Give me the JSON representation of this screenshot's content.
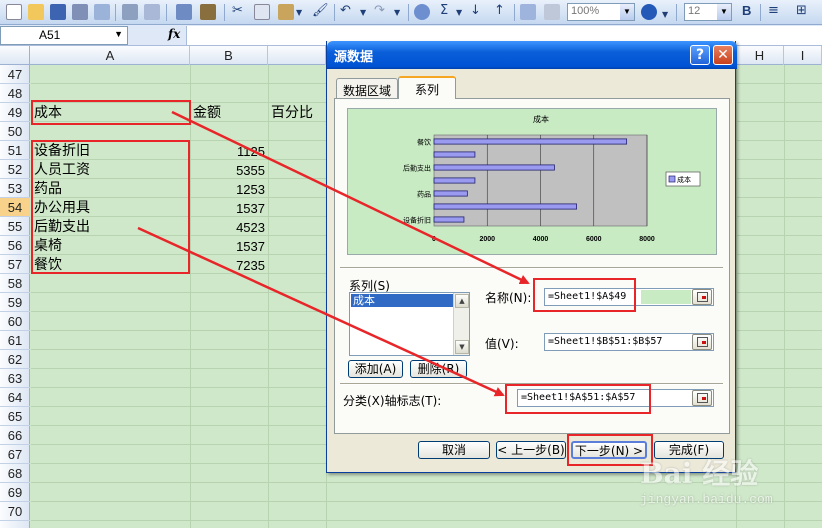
{
  "toolbar": {
    "zoom": "100%",
    "font_size": "12",
    "bold_label": "B"
  },
  "formula_bar": {
    "name_box": "A51",
    "fx_label": "fx",
    "formula": ""
  },
  "sheet": {
    "columns": [
      "A",
      "B",
      "",
      "",
      "",
      "",
      "",
      "H",
      "I"
    ],
    "rows": [
      "47",
      "48",
      "49",
      "50",
      "51",
      "52",
      "53",
      "54",
      "55",
      "56",
      "57",
      "58",
      "59",
      "60",
      "61",
      "62",
      "63",
      "64",
      "65",
      "66",
      "67",
      "68",
      "69",
      "70"
    ],
    "selected_row": "54",
    "header_row": {
      "a": "成本",
      "b": "金额",
      "c": "百分比"
    },
    "data_rows": [
      {
        "label": "设备折旧",
        "value": "1125"
      },
      {
        "label": "人员工资",
        "value": "5355"
      },
      {
        "label": "药品",
        "value": "1253"
      },
      {
        "label": "办公用具",
        "value": "1537"
      },
      {
        "label": "后勤支出",
        "value": "4523"
      },
      {
        "label": "桌椅",
        "value": "1537"
      },
      {
        "label": "餐饮",
        "value": "7235"
      }
    ]
  },
  "dialog": {
    "title": "源数据",
    "help": "?",
    "close": "✕",
    "tabs": [
      "数据区域",
      "系列"
    ],
    "active_tab": "系列",
    "series_label": "系列(S)",
    "series_items": [
      "成本"
    ],
    "name_label": "名称(N):",
    "name_ref": "=Sheet1!$A$49",
    "value_label": "值(V):",
    "value_ref": "=Sheet1!$B$51:$B$57",
    "category_label": "分类(X)轴标志(T):",
    "category_ref": "=Sheet1!$A$51:$A$57",
    "add_button": "添加(A)",
    "delete_button": "删除(R)",
    "cancel_button": "取消",
    "back_button": "< 上一步(B)",
    "next_button": "下一步(N) >",
    "finish_button": "完成(F)"
  },
  "chart_data": {
    "type": "bar",
    "title": "成本",
    "categories": [
      "设备折旧",
      "药品",
      "后勤支出",
      "餐饮"
    ],
    "series": [
      {
        "name": "成本",
        "values": [
          1125,
          5355,
          1253,
          1537,
          4523,
          1537,
          7235
        ]
      }
    ],
    "bar_categories": [
      "设备折旧",
      "人员工资",
      "药品",
      "办公用具",
      "后勤支出",
      "桌椅",
      "餐饮"
    ],
    "x_ticks": [
      "0",
      "2000",
      "4000",
      "6000",
      "8000"
    ],
    "xlim": [
      0,
      8000
    ],
    "legend": "成本",
    "legend_position": "right",
    "grid": true,
    "colors": {
      "bar": "#9a9af0",
      "plot_bg": "#c0c0c0",
      "chart_bg": "#c8ebc4"
    }
  },
  "watermark": {
    "main": "Bai 经验",
    "sub": "jingyan.baidu.com"
  }
}
